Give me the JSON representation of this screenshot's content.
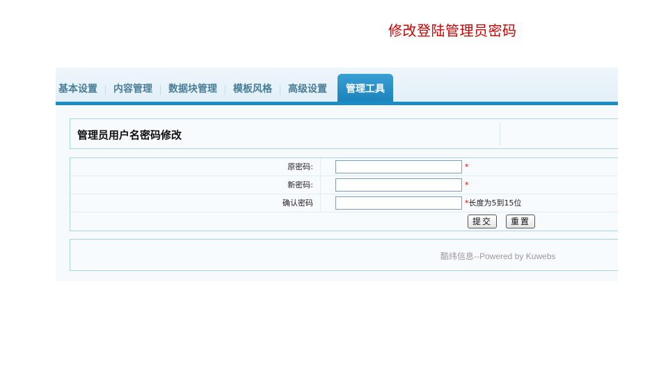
{
  "page": {
    "heading": "修改登陆管理员密码"
  },
  "tabs": [
    {
      "label": "基本设置",
      "active": false
    },
    {
      "label": "内容管理",
      "active": false
    },
    {
      "label": "数据块管理",
      "active": false
    },
    {
      "label": "模板风格",
      "active": false
    },
    {
      "label": "高级设置",
      "active": false
    },
    {
      "label": "管理工具",
      "active": true
    }
  ],
  "section": {
    "title": "管理员用户名密码修改"
  },
  "form": {
    "old_password": {
      "label": "原密码:",
      "value": "",
      "required_mark": "*",
      "hint": ""
    },
    "new_password": {
      "label": "新密码:",
      "value": "",
      "required_mark": "*",
      "hint": ""
    },
    "confirm_password": {
      "label": "确认密码",
      "value": "",
      "required_mark": "*",
      "hint": "长度为5到15位"
    },
    "submit_label": "提交",
    "reset_label": "重置"
  },
  "footer": {
    "text": "酷纬信息--Powered by Kuwebs"
  },
  "colors": {
    "heading": "#cc0000",
    "tab_active_bg": "#1b8cc4",
    "tab_text": "#4a7e96",
    "border": "#a7d4e8",
    "required": "#e00000"
  }
}
